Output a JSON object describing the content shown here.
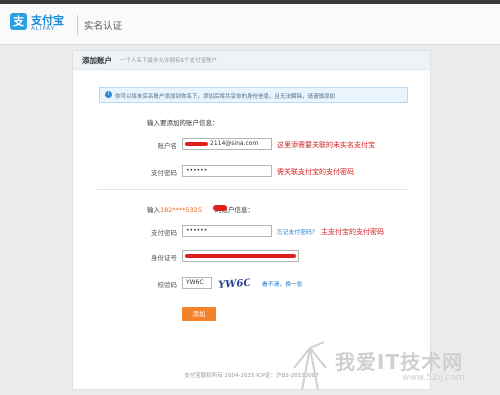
{
  "brand": {
    "logo_glyph": "支",
    "name_cn": "支付宝",
    "name_en": "ALIPAY",
    "page_title": "实名认证"
  },
  "card": {
    "title": "添加账户",
    "subtitle": "一个人名下最多允许拥有6个支付宝账户",
    "notice": "你可以将未实名账户添加到你名下，添加后将共享你的身份信息，且无法解除，请谨慎添加"
  },
  "section1": {
    "label": "输入要添加的账户信息：",
    "account_label": "账户名",
    "account_value": "2114@sina.com",
    "password_label": "支付密码",
    "password_value": "••••••",
    "annot_account": "这里添需要关联的未实名支付宝",
    "annot_password": "需关联支付宝的支付密码"
  },
  "section2": {
    "label_prefix": "输入",
    "phone": "182****5325",
    "label_suffix": "的账户信息：",
    "password_label": "支付密码",
    "password_value": "••••••",
    "forgot_link": "忘记支付密码?",
    "annot_password": "主支付宝的支付密码",
    "id_label": "身份证号",
    "captcha_label": "校验码",
    "captcha_value": "YW6C",
    "captcha_image_text": "YW6C",
    "refresh_link": "看不清，换一张",
    "submit_label": "添加"
  },
  "footer": "支付宝版权所有 2004-2015 ICP证：沪B2-20150087",
  "watermark": {
    "text": "我爱IT技术网",
    "url": "www.52ij.com"
  },
  "colors": {
    "accent": "#1a8ad6",
    "annotation": "#d42020",
    "button": "#f3822a"
  }
}
